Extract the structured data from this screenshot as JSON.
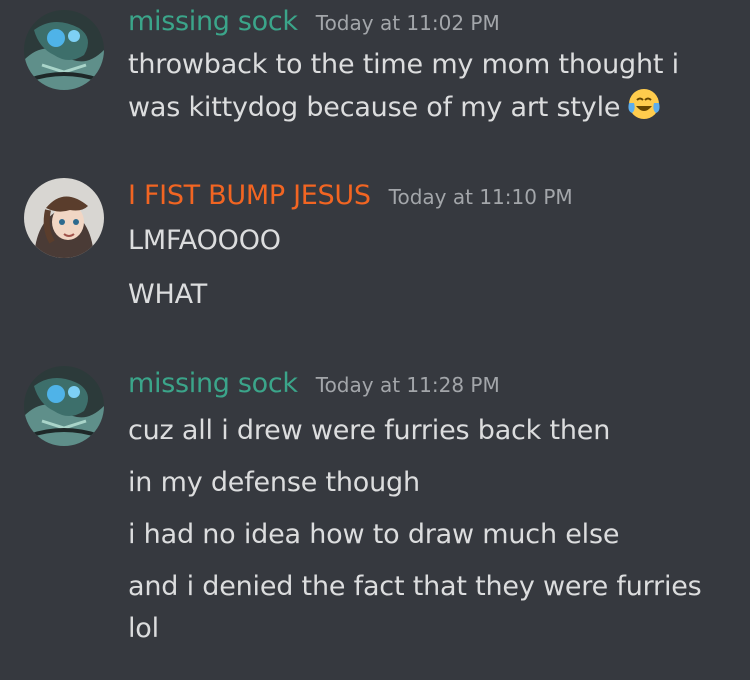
{
  "messages": [
    {
      "author": "missing sock",
      "author_color": "#3ba58a",
      "time": "Today at 11:02 PM",
      "lines": [
        "throwback to the time my mom thought i was kittydog because of my art style"
      ],
      "emoji": "face-with-tears-of-joy-icon"
    },
    {
      "author": "I FIST BUMP JESUS",
      "author_color": "#f26522",
      "time": "Today at 11:10 PM",
      "lines": [
        "LMFAOOOO",
        "WHAT"
      ]
    },
    {
      "author": "missing sock",
      "author_color": "#3ba58a",
      "time": "Today at 11:28 PM",
      "lines": [
        "cuz all i drew were furries back then",
        "in my defense though",
        "i had no idea how to draw much else",
        "and i denied the fact that they were furries lol"
      ]
    }
  ],
  "colors": {
    "background": "#36393f",
    "text": "#dcddde",
    "timestamp": "#a3a6aa"
  }
}
